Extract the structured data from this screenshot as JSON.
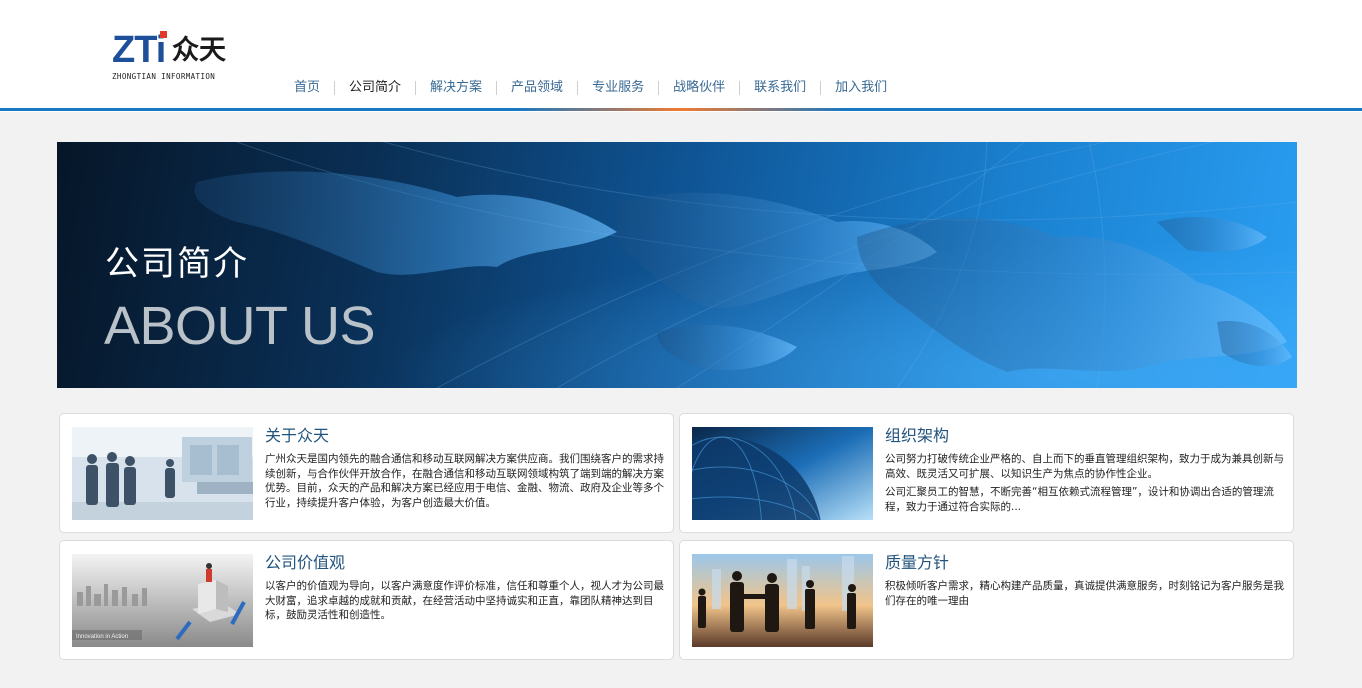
{
  "logo": {
    "mark": "ZTi",
    "cn": "众天",
    "sub": "ZHONGTIAN INFORMATION"
  },
  "nav": {
    "items": [
      "首页",
      "公司简介",
      "解决方案",
      "产品领域",
      "专业服务",
      "战略伙伴",
      "联系我们",
      "加入我们"
    ],
    "active": "公司简介"
  },
  "banner": {
    "title_cn": "公司简介",
    "title_en": "ABOUT US"
  },
  "cards": [
    {
      "title": "关于众天",
      "text": [
        "广州众天是国内领先的融合通信和移动互联网解决方案供应商。我们围绕客户的需求持续创新，与合作伙伴开放合作，在融合通信和移动互联网领域构筑了端到端的解决方案优势。目前，众天的产品和解决方案已经应用于电信、金融、物流、政府及企业等多个行业，持续提升客户体验，为客户创造最大价值。"
      ]
    },
    {
      "title": "组织架构",
      "text": [
        "公司努力打破传统企业严格的、自上而下的垂直管理组织架构，致力于成为兼具创新与高效、既灵活又可扩展、以知识生产为焦点的协作性企业。",
        "公司汇聚员工的智慧，不断完善“相互依赖式流程管理”，设计和协调出合适的管理流程，致力于通过符合实际的..."
      ]
    },
    {
      "title": "公司价值观",
      "text": [
        "以客户的价值观为导向，以客户满意度作评价标准，信任和尊重个人，视人才为公司最大财富，追求卓越的成就和贡献，在经营活动中坚持诚实和正直，靠团队精神达到目标，鼓励灵活性和创造性。"
      ],
      "image_caption": "Innovation in Action"
    },
    {
      "title": "质量方针",
      "text": [
        "积极倾听客户需求，精心构建产品质量，真诚提供满意服务，时刻铭记为客户服务是我们存在的唯一理由"
      ]
    }
  ],
  "colors": {
    "accent_blue": "#1a78c2",
    "accent_orange": "#f07a32",
    "card_title": "#23547e",
    "nav_link": "#3a6a94"
  }
}
